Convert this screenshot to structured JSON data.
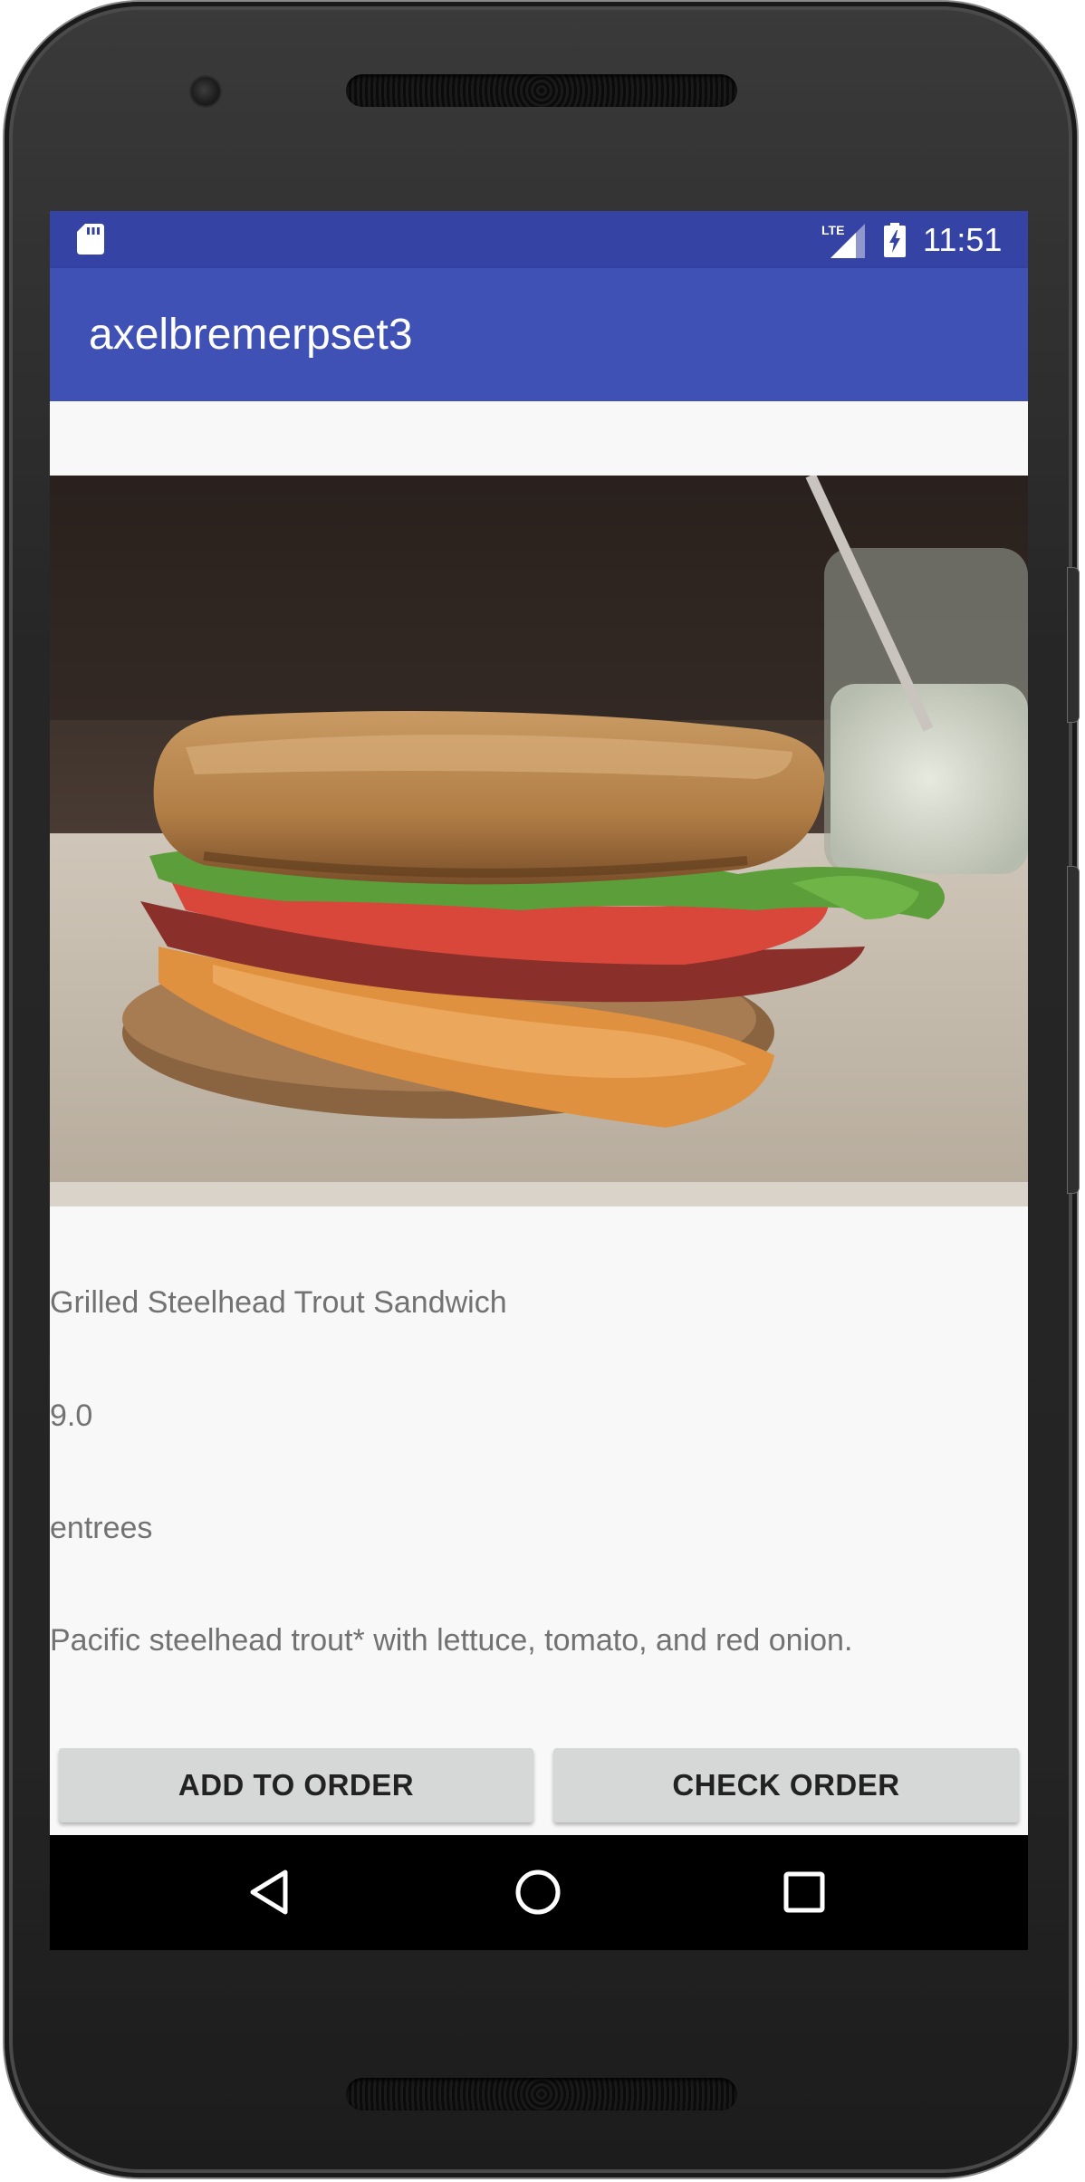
{
  "status_bar": {
    "time": "11:51",
    "network_label": "LTE",
    "icons": [
      "sd-card-icon",
      "lte-signal-icon",
      "battery-charging-icon"
    ]
  },
  "app_bar": {
    "title": "axelbremerpset3"
  },
  "item": {
    "image_icon": "sandwich-photo",
    "name": "Grilled Steelhead Trout Sandwich",
    "price": "9.0",
    "category": "entrees",
    "description": "Pacific steelhead trout* with lettuce, tomato, and red onion."
  },
  "buttons": {
    "add_to_order": "ADD TO ORDER",
    "check_order": "CHECK ORDER"
  },
  "nav_bar": {
    "icons": [
      "back-icon",
      "home-icon",
      "recents-icon"
    ]
  },
  "colors": {
    "status_bar": "#3443a4",
    "app_bar": "#3f51b5",
    "background": "#f8f8f8",
    "button": "#d6d7d7",
    "text_secondary": "#727272"
  }
}
